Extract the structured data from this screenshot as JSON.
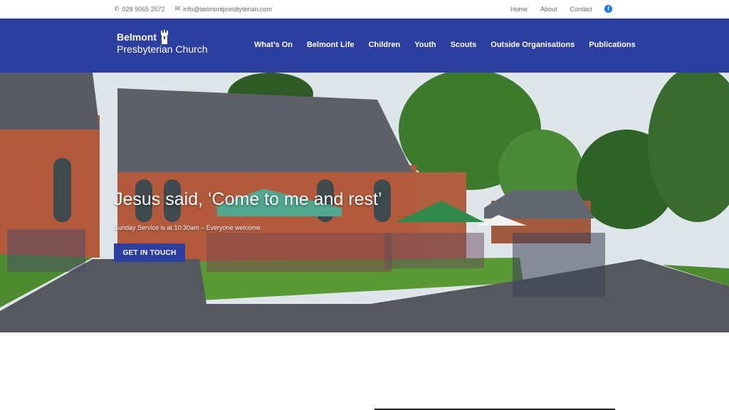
{
  "topbar": {
    "phone": "028 9065 2572",
    "email": "info@belmontpresbyterian.com",
    "links": [
      "Home",
      "About",
      "Contact"
    ],
    "social_icon": "facebook-icon"
  },
  "header": {
    "logo_line1": "Belmont",
    "logo_line2": "Presbyterian Church",
    "logo_icon": "church-tower-icon",
    "nav": [
      "What’s On",
      "Belmont Life",
      "Children",
      "Youth",
      "Scouts",
      "Outside Organisations",
      "Publications"
    ]
  },
  "hero": {
    "title": "Jesus said, ‘Come to me and rest’",
    "subtitle": "Sunday Service is at 10:30am – Everyone welcome",
    "button": "GET IN TOUCH"
  },
  "colors": {
    "brand_blue": "#2c3fa0",
    "facebook": "#1877f2"
  }
}
